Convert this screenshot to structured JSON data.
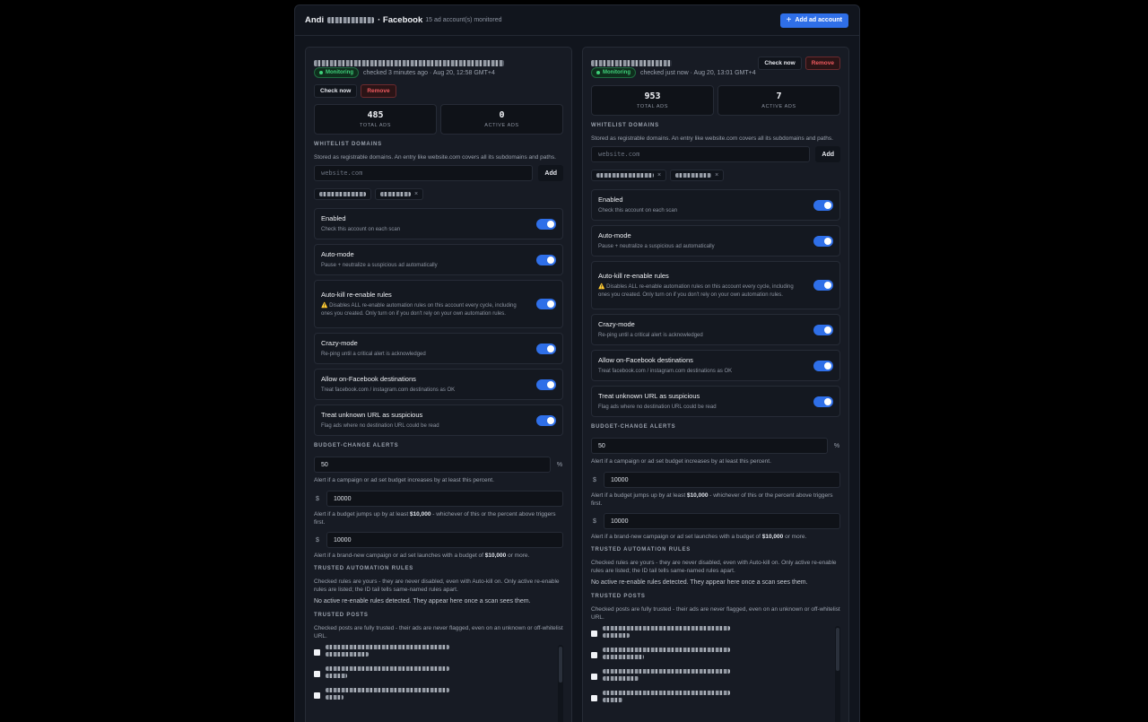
{
  "header": {
    "owner_first": "Andi",
    "platform": "· Facebook",
    "monitored": "15 ad account(s) monitored",
    "add_account_label": "Add ad account"
  },
  "icons": {
    "add": "plus-icon",
    "status": "dot-icon",
    "warning": "warning-icon",
    "remove_chip": "close-icon"
  },
  "colors": {
    "accent": "#2f6fe8",
    "monitoring": "#3fd07a",
    "danger": "#ef5a5f"
  },
  "accounts": [
    {
      "status": "Monitoring",
      "checked": "checked 3 minutes ago · Aug 20, 12:58 GMT+4",
      "check_now": "Check now",
      "remove": "Remove",
      "total_ads": "485",
      "total_ads_label": "TOTAL ADS",
      "active_ads": "0",
      "active_ads_label": "ACTIVE ADS"
    },
    {
      "status": "Monitoring",
      "checked": "checked just now · Aug 20, 13:01 GMT+4",
      "check_now": "Check now",
      "remove": "Remove",
      "total_ads": "953",
      "total_ads_label": "TOTAL ADS",
      "active_ads": "7",
      "active_ads_label": "ACTIVE ADS"
    }
  ],
  "whitelist": {
    "title": "WHITELIST DOMAINS",
    "help": "Stored as registrable domains. An entry like website.com covers all its subdomains and paths.",
    "placeholder": "website.com",
    "add": "Add"
  },
  "toggles": {
    "enabled": {
      "title": "Enabled",
      "desc": "Check this account on each scan"
    },
    "auto_mode": {
      "title": "Auto-mode",
      "desc": "Pause + neutralize a suspicious ad automatically"
    },
    "auto_kill": {
      "title": "Auto-kill re-enable rules",
      "warn": "⚠️",
      "desc": "Disables ALL re-enable automation rules on this account every cycle, including ones you created. Only turn on if you don't rely on your own automation rules."
    },
    "crazy": {
      "title": "Crazy-mode",
      "desc": "Re-ping until a critical alert is acknowledged"
    },
    "on_fb": {
      "title": "Allow on-Facebook destinations",
      "desc": "Treat facebook.com / instagram.com destinations as OK"
    },
    "unknown_url": {
      "title": "Treat unknown URL as suspicious",
      "desc": "Flag ads where no destination URL could be read"
    }
  },
  "budget": {
    "title": "BUDGET-CHANGE ALERTS",
    "percent_value": "50",
    "percent_unit": "%",
    "percent_help": "Alert if a campaign or ad set budget increases by at least this percent.",
    "currency": "$",
    "jump_value": "10000",
    "jump_help_a": "Alert if a budget jumps up by at least ",
    "jump_help_amount": "$10,000",
    "jump_help_b": " - whichever of this or the percent above triggers first.",
    "new_value": "10000",
    "new_help_a": "Alert if a brand-new campaign or ad set launches with a budget of ",
    "new_help_amount": "$10,000",
    "new_help_b": " or more."
  },
  "rules": {
    "title": "TRUSTED AUTOMATION RULES",
    "help": "Checked rules are yours - they are never disabled, even with Auto-kill on. Only active re-enable rules are listed; the ID tail tells same-named rules apart.",
    "empty": "No active re-enable rules detected. They appear here once a scan sees them."
  },
  "posts": {
    "title": "TRUSTED POSTS",
    "help": "Checked posts are fully trusted - their ads are never flagged, even on an unknown or off-whitelist URL."
  }
}
